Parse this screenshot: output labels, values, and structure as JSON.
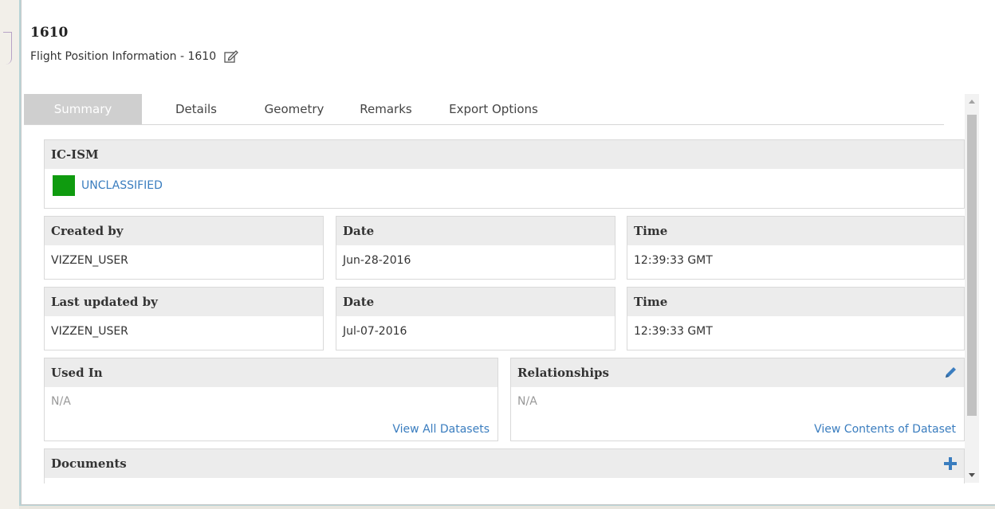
{
  "header": {
    "title": "1610",
    "subtitle": "Flight Position Information - 1610"
  },
  "tabs": [
    {
      "label": "Summary",
      "active": true
    },
    {
      "label": "Details",
      "active": false
    },
    {
      "label": "Geometry",
      "active": false
    },
    {
      "label": "Remarks",
      "active": false
    },
    {
      "label": "Export Options",
      "active": false
    }
  ],
  "ic_ism": {
    "header": "IC-ISM",
    "classification": "UNCLASSIFIED",
    "color": "#0f9b0f"
  },
  "created": {
    "by_label": "Created by",
    "by_value": "VIZZEN_USER",
    "date_label": "Date",
    "date_value": "Jun-28-2016",
    "time_label": "Time",
    "time_value": "12:39:33 GMT"
  },
  "updated": {
    "by_label": "Last updated by",
    "by_value": "VIZZEN_USER",
    "date_label": "Date",
    "date_value": "Jul-07-2016",
    "time_label": "Time",
    "time_value": "12:39:33 GMT"
  },
  "used_in": {
    "header": "Used In",
    "value": "N/A",
    "link": "View All Datasets"
  },
  "relationships": {
    "header": "Relationships",
    "value": "N/A",
    "link": "View Contents of Dataset"
  },
  "documents": {
    "header": "Documents"
  },
  "colors": {
    "link": "#3a7dbf",
    "header_bg": "#ececec",
    "active_tab": "#cfcfcf"
  },
  "icons": [
    "edit-note-icon",
    "pencil-icon",
    "plus-icon",
    "scroll-up-icon",
    "scroll-down-icon"
  ]
}
